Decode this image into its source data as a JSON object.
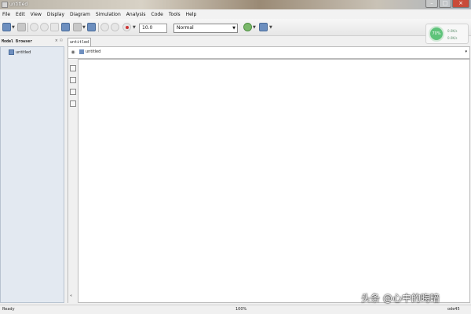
{
  "window": {
    "title": "untitled",
    "minimize": "–",
    "maximize": "□",
    "close": "×"
  },
  "menu": [
    "File",
    "Edit",
    "View",
    "Display",
    "Diagram",
    "Simulation",
    "Analysis",
    "Code",
    "Tools",
    "Help"
  ],
  "toolbar": {
    "stop_time": "10.0",
    "sim_mode": "Normal"
  },
  "widget": {
    "percent": "70%",
    "up_rate": "0.0K/s",
    "down_rate": "0.0K/s"
  },
  "browser": {
    "header": "Model Browser",
    "controls": "× ☉",
    "item": "untitled"
  },
  "editor": {
    "tab": "untitled",
    "breadcrumb": "untitled",
    "dropdown": "▾"
  },
  "status": {
    "left": "Ready",
    "center": "100%",
    "right": "ode45"
  },
  "watermark": "头条 @心中的晦暗",
  "colors": {
    "model_browser_bg": "#e3e9f1",
    "canvas_bg": "#ffffff",
    "widget_green": "#5ec37a"
  }
}
